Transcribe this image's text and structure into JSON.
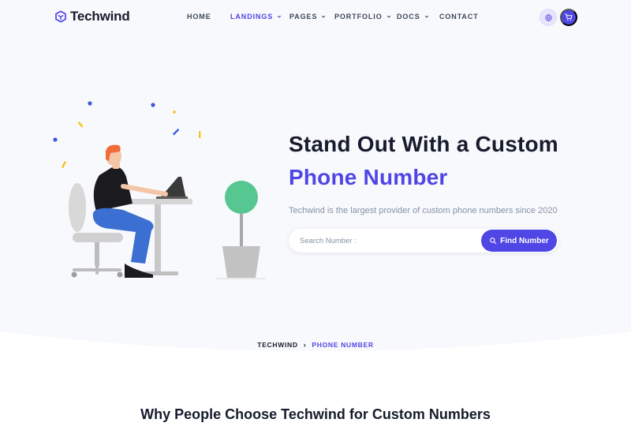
{
  "brand": {
    "name": "Techwind",
    "color": "#4f46e5"
  },
  "nav": {
    "items": [
      {
        "label": "HOME",
        "dropdown": false,
        "active": false
      },
      {
        "label": "LANDINGS",
        "dropdown": true,
        "active": true
      },
      {
        "label": "PAGES",
        "dropdown": true,
        "active": false
      },
      {
        "label": "PORTFOLIO",
        "dropdown": true,
        "active": false
      },
      {
        "label": "DOCS",
        "dropdown": true,
        "active": false
      },
      {
        "label": "CONTACT",
        "dropdown": false,
        "active": false
      }
    ],
    "icons": [
      "settings-icon",
      "cart-icon"
    ]
  },
  "hero": {
    "title": "Stand Out With a Custom",
    "title_accent": "Phone Number",
    "subtitle": "Techwind is the largest provider of custom phone numbers since 2020",
    "search": {
      "placeholder": "Search Number :",
      "value": "",
      "button_label": "Find Number",
      "button_icon": "search-icon"
    },
    "illustration": "person-at-desk-with-laptop-and-plant"
  },
  "breadcrumb": {
    "home": "TECHWIND",
    "current": "PHONE NUMBER"
  },
  "section": {
    "title": "Why People Choose Techwind for Custom Numbers"
  },
  "colors": {
    "accent": "#4f46e5",
    "dark": "#161c2d",
    "muted": "#8492a6",
    "hero_bg": "#f8f9fc"
  }
}
